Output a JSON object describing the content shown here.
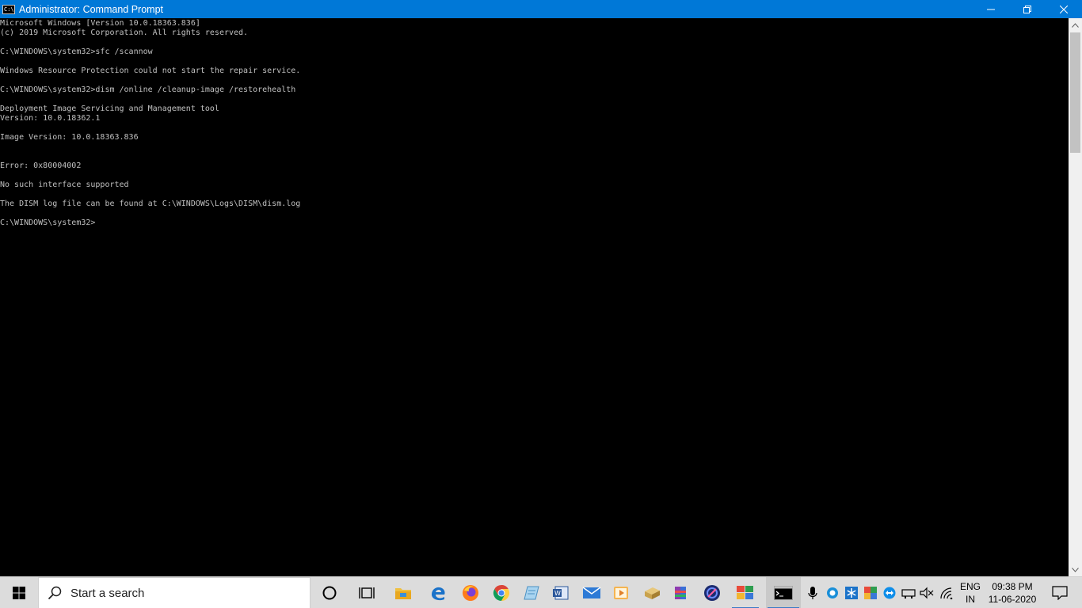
{
  "window": {
    "title": "Administrator: Command Prompt",
    "icon_text": "C:\\."
  },
  "console": {
    "lines": [
      "Microsoft Windows [Version 10.0.18363.836]",
      "(c) 2019 Microsoft Corporation. All rights reserved.",
      "",
      "C:\\WINDOWS\\system32>sfc /scannow",
      "",
      "Windows Resource Protection could not start the repair service.",
      "",
      "C:\\WINDOWS\\system32>dism /online /cleanup-image /restorehealth",
      "",
      "Deployment Image Servicing and Management tool",
      "Version: 10.0.18362.1",
      "",
      "Image Version: 10.0.18363.836",
      "",
      "",
      "Error: 0x80004002",
      "",
      "No such interface supported",
      "",
      "The DISM log file can be found at C:\\WINDOWS\\Logs\\DISM\\dism.log",
      "",
      "C:\\WINDOWS\\system32>"
    ]
  },
  "taskbar": {
    "search_placeholder": "Start a search",
    "pinned": [
      "cortana-icon",
      "task-view-icon",
      "file-explorer-icon",
      "edge-icon",
      "firefox-icon",
      "chrome-icon",
      "notepad-icon",
      "word-icon",
      "mail-icon",
      "media-player-icon",
      "archive-icon",
      "winrar-icon",
      "photo-icon",
      "gallery-icon",
      "command-prompt-icon"
    ],
    "tray": [
      "microphone-icon",
      "cloud-icon",
      "snowflake-icon",
      "security-icon",
      "teamviewer-icon",
      "network-adapter-icon",
      "volume-muted-icon",
      "wifi-icon"
    ],
    "language": {
      "line1": "ENG",
      "line2": "IN"
    },
    "clock": {
      "time": "09:38 PM",
      "date": "11-06-2020"
    }
  },
  "colors": {
    "titlebar": "#0078d7",
    "console_bg": "#000000",
    "console_text": "#c0c0c0",
    "taskbar": "#dcdcdc"
  }
}
